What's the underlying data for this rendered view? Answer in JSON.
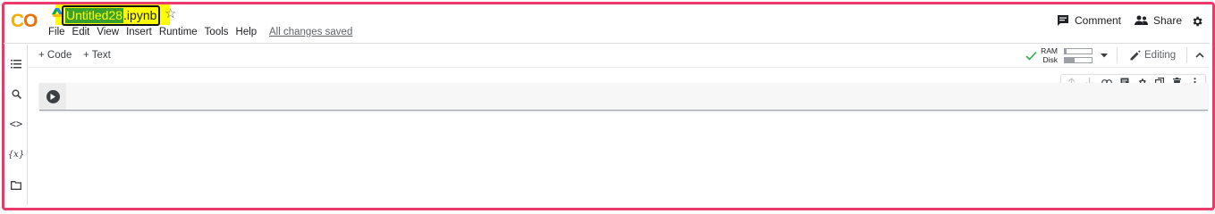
{
  "app": {
    "logo_text": "CO",
    "notebook_name_highlight": "Untitled28",
    "notebook_name_ext": ".ipynb",
    "save_status": "All changes saved"
  },
  "menu": [
    "File",
    "Edit",
    "View",
    "Insert",
    "Runtime",
    "Tools",
    "Help"
  ],
  "header_actions": {
    "comment_label": "Comment",
    "share_label": "Share"
  },
  "toolbar": {
    "add_code_label": "+ Code",
    "add_text_label": "+ Text",
    "ram_label": "RAM",
    "disk_label": "Disk",
    "ram_usage": 0.05,
    "disk_usage": 0.35,
    "editing_label": "Editing"
  },
  "colors": {
    "accent_border": "#ec3b6a",
    "connected_check": "#34a853",
    "logo_orange": "#f9ab00",
    "logo_dark_orange": "#e8710a",
    "highlight_yellow": "#ffff00",
    "highlight_green": "#3aa02c"
  },
  "icons": {
    "sidebar": [
      "toc-icon",
      "search-icon",
      "code-snippets-icon",
      "variables-icon",
      "files-icon"
    ],
    "cell_toolbar": [
      "move-up-icon",
      "move-down-icon",
      "link-icon",
      "comment-icon",
      "settings-icon",
      "mirror-cell-icon",
      "delete-icon",
      "more-icon"
    ]
  }
}
